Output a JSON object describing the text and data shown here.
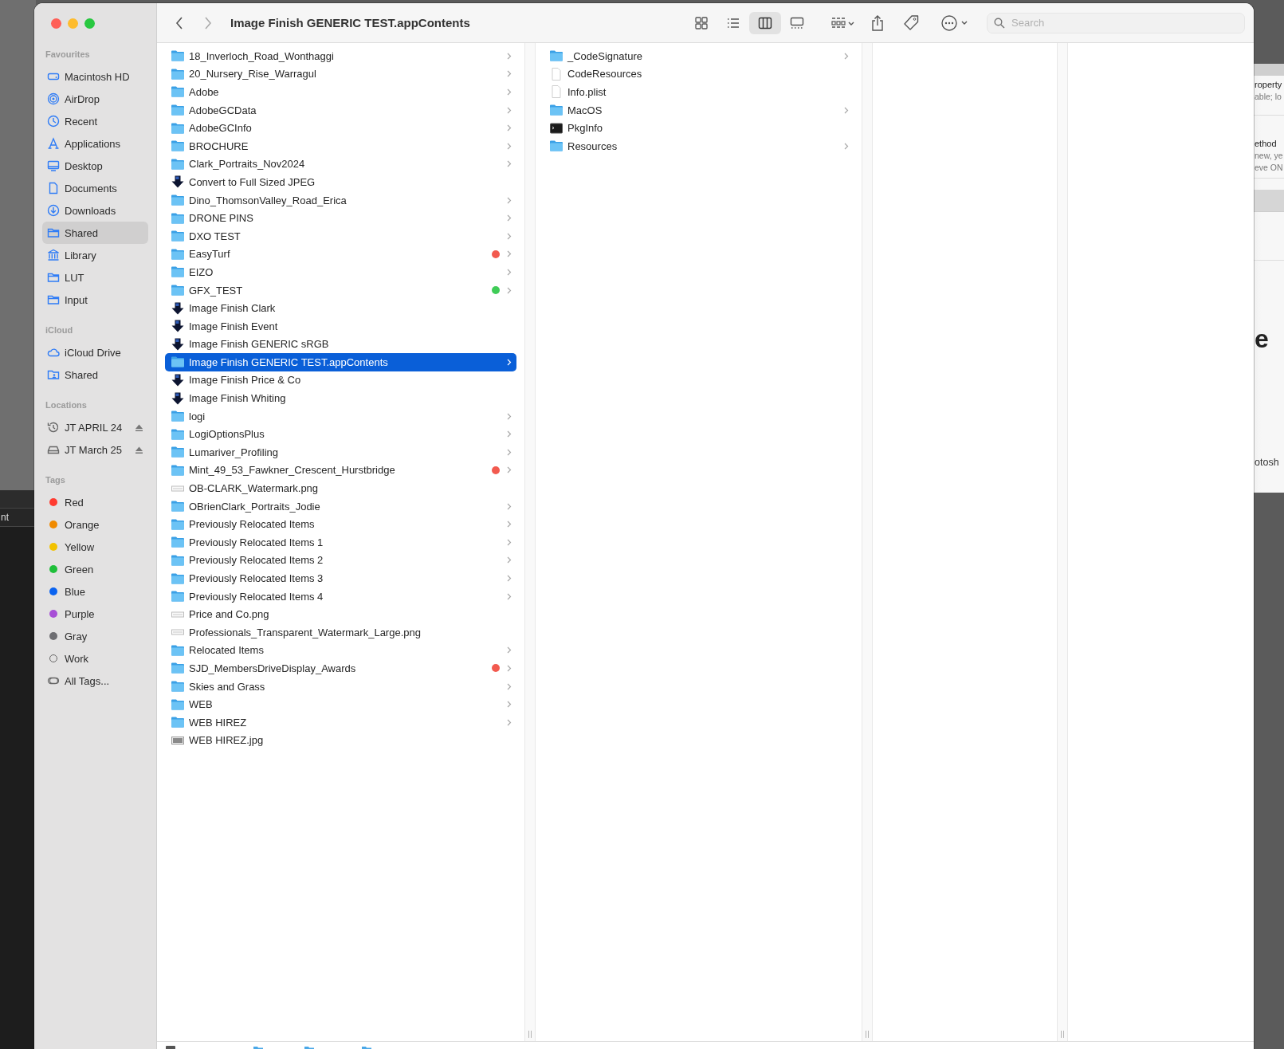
{
  "window": {
    "title": "Image Finish GENERIC TEST.appContents"
  },
  "toolbar": {
    "views": [
      {
        "kind": "icons",
        "selected": false
      },
      {
        "kind": "list",
        "selected": false
      },
      {
        "kind": "columns",
        "selected": true
      },
      {
        "kind": "gallery",
        "selected": false
      }
    ],
    "search": {
      "placeholder": "Search"
    }
  },
  "sidebar": {
    "sections": [
      {
        "title": "Favourites",
        "items": [
          {
            "label": "Macintosh HD",
            "kind": "disk",
            "selected": false
          },
          {
            "label": "AirDrop",
            "kind": "airdrop",
            "selected": false
          },
          {
            "label": "Recent",
            "kind": "clock",
            "selected": false
          },
          {
            "label": "Applications",
            "kind": "apps",
            "selected": false
          },
          {
            "label": "Desktop",
            "kind": "desktop",
            "selected": false
          },
          {
            "label": "Documents",
            "kind": "document",
            "selected": false
          },
          {
            "label": "Downloads",
            "kind": "download",
            "selected": false
          },
          {
            "label": "Shared",
            "kind": "folder",
            "selected": true
          },
          {
            "label": "Library",
            "kind": "library",
            "selected": false
          },
          {
            "label": "LUT",
            "kind": "folder",
            "selected": false
          },
          {
            "label": "Input",
            "kind": "folder",
            "selected": false
          }
        ]
      },
      {
        "title": "iCloud",
        "items": [
          {
            "label": "iCloud Drive",
            "kind": "cloud",
            "selected": false
          },
          {
            "label": "Shared",
            "kind": "sharedfolder",
            "selected": false
          }
        ]
      },
      {
        "title": "Locations",
        "items": [
          {
            "label": "JT APRIL 24",
            "kind": "timemachine",
            "selected": false,
            "ejectable": true
          },
          {
            "label": "JT March 25",
            "kind": "drive",
            "selected": false,
            "ejectable": true
          }
        ]
      },
      {
        "title": "Tags",
        "items": [
          {
            "label": "Red",
            "kind": "tag",
            "color": "#ff3b30",
            "selected": false
          },
          {
            "label": "Orange",
            "kind": "tag",
            "color": "#f08a00",
            "selected": false
          },
          {
            "label": "Yellow",
            "kind": "tag",
            "color": "#f2c200",
            "selected": false
          },
          {
            "label": "Green",
            "kind": "tag",
            "color": "#1fbf3a",
            "selected": false
          },
          {
            "label": "Blue",
            "kind": "tag",
            "color": "#0a63f0",
            "selected": false
          },
          {
            "label": "Purple",
            "kind": "tag",
            "color": "#a74fd6",
            "selected": false
          },
          {
            "label": "Gray",
            "kind": "tag",
            "color": "#6e6e72",
            "selected": false
          },
          {
            "label": "Work",
            "kind": "hollowtag",
            "selected": false
          },
          {
            "label": "All Tags...",
            "kind": "alltags",
            "selected": false
          }
        ]
      }
    ]
  },
  "columns": [
    {
      "items": [
        {
          "label": "18_Inverloch_Road_Wonthaggi",
          "kind": "folder",
          "selected": false
        },
        {
          "label": "20_Nursery_Rise_Warragul",
          "kind": "folder",
          "selected": false
        },
        {
          "label": "Adobe",
          "kind": "folder",
          "selected": false
        },
        {
          "label": "AdobeGCData",
          "kind": "folder",
          "selected": false
        },
        {
          "label": "AdobeGCInfo",
          "kind": "folder",
          "selected": false
        },
        {
          "label": "BROCHURE",
          "kind": "folder",
          "selected": false
        },
        {
          "label": "Clark_Portraits_Nov2024",
          "kind": "folder",
          "selected": false
        },
        {
          "label": "Convert to Full Sized JPEG",
          "kind": "droplet",
          "selected": false
        },
        {
          "label": "Dino_ThomsonValley_Road_Erica",
          "kind": "folder",
          "selected": false
        },
        {
          "label": "DRONE PINS",
          "kind": "folder",
          "selected": false
        },
        {
          "label": "DXO TEST",
          "kind": "folder",
          "selected": false
        },
        {
          "label": "EasyTurf",
          "kind": "folder",
          "color": "#f25a4f",
          "selected": false
        },
        {
          "label": "EIZO",
          "kind": "folder",
          "selected": false
        },
        {
          "label": "GFX_TEST",
          "kind": "folder",
          "color": "#3fcc57",
          "selected": false
        },
        {
          "label": "Image Finish Clark",
          "kind": "droplet",
          "selected": false
        },
        {
          "label": "Image Finish Event",
          "kind": "droplet",
          "selected": false
        },
        {
          "label": "Image Finish GENERIC sRGB",
          "kind": "droplet",
          "selected": false
        },
        {
          "label": "Image Finish GENERIC TEST.appContents",
          "kind": "folder",
          "selected": true
        },
        {
          "label": "Image Finish Price & Co",
          "kind": "droplet",
          "selected": false
        },
        {
          "label": "Image Finish Whiting",
          "kind": "droplet",
          "selected": false
        },
        {
          "label": "logi",
          "kind": "folder",
          "selected": false
        },
        {
          "label": "LogiOptionsPlus",
          "kind": "folder",
          "selected": false
        },
        {
          "label": "Lumariver_Profiling",
          "kind": "folder",
          "selected": false
        },
        {
          "label": "Mint_49_53_Fawkner_Crescent_Hurstbridge",
          "kind": "folder",
          "color": "#f25a4f",
          "selected": false
        },
        {
          "label": "OB-CLARK_Watermark.png",
          "kind": "image",
          "selected": false
        },
        {
          "label": "OBrienClark_Portraits_Jodie",
          "kind": "folder",
          "selected": false
        },
        {
          "label": "Previously Relocated Items",
          "kind": "folder",
          "selected": false
        },
        {
          "label": "Previously Relocated Items 1",
          "kind": "folder",
          "selected": false
        },
        {
          "label": "Previously Relocated Items 2",
          "kind": "folder",
          "selected": false
        },
        {
          "label": "Previously Relocated Items 3",
          "kind": "folder",
          "selected": false
        },
        {
          "label": "Previously Relocated Items 4",
          "kind": "folder",
          "selected": false
        },
        {
          "label": "Price and Co.png",
          "kind": "image",
          "selected": false
        },
        {
          "label": "Professionals_Transparent_Watermark_Large.png",
          "kind": "image",
          "selected": false
        },
        {
          "label": "Relocated Items",
          "kind": "folder",
          "selected": false
        },
        {
          "label": "SJD_MembersDriveDisplay_Awards",
          "kind": "folder",
          "color": "#f25a4f",
          "selected": false
        },
        {
          "label": "Skies and Grass",
          "kind": "folder",
          "selected": false
        },
        {
          "label": "WEB",
          "kind": "folder",
          "selected": false
        },
        {
          "label": "WEB HIREZ",
          "kind": "folder",
          "selected": false
        },
        {
          "label": "WEB HIREZ.jpg",
          "kind": "photo",
          "selected": false
        }
      ]
    },
    {
      "items": [
        {
          "label": "_CodeSignature",
          "kind": "folder",
          "selected": false
        },
        {
          "label": "CodeResources",
          "kind": "document",
          "selected": false
        },
        {
          "label": "Info.plist",
          "kind": "document",
          "selected": false
        },
        {
          "label": "MacOS",
          "kind": "folder",
          "selected": false
        },
        {
          "label": "PkgInfo",
          "kind": "executable",
          "selected": false
        },
        {
          "label": "Resources",
          "kind": "folder",
          "selected": false
        }
      ]
    },
    {},
    {}
  ],
  "background": {
    "left_window": {
      "texts": [
        "nt"
      ]
    },
    "right_window": {
      "rows": [
        {
          "title": "roperty",
          "lines": [
            "able; lo"
          ]
        },
        {
          "title": "ethod",
          "lines": [
            "new, ye",
            "eve ON"
          ]
        }
      ],
      "heading": "e",
      "caption": "otosh"
    }
  }
}
